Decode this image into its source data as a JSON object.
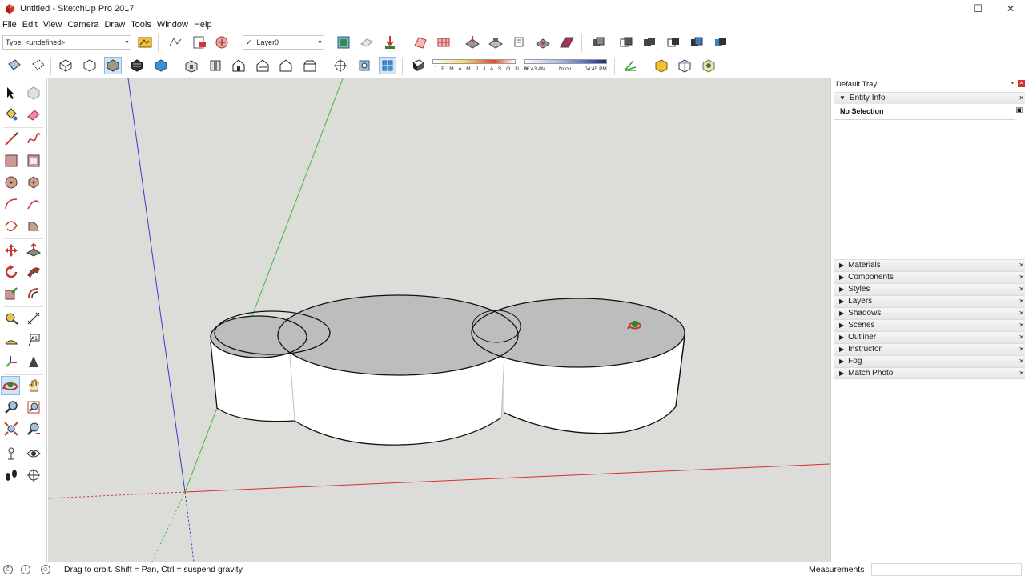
{
  "window": {
    "title": "Untitled - SketchUp Pro 2017",
    "minimize_glyph": "—",
    "maximize_glyph": "☐",
    "close_glyph": "✕"
  },
  "menu": [
    "File",
    "Edit",
    "View",
    "Camera",
    "Draw",
    "Tools",
    "Window",
    "Help"
  ],
  "toolbar": {
    "type_selector": {
      "value": "Type: <undefined>"
    },
    "layer_selector": {
      "check": "✓",
      "value": "Layer0"
    },
    "shadow_months": "J F M A M J J A S O N D",
    "shadow_time_start": "06:43 AM",
    "shadow_time_noon": "Noon",
    "shadow_time_end": "04:45 PM"
  },
  "tray": {
    "title": "Default Tray",
    "entity_info": {
      "label": "Entity Info",
      "content": "No Selection"
    },
    "panels": [
      "Materials",
      "Components",
      "Styles",
      "Layers",
      "Shadows",
      "Scenes",
      "Outliner",
      "Instructor",
      "Fog",
      "Match Photo"
    ]
  },
  "statusbar": {
    "message": "Drag to orbit. Shift = Pan, Ctrl = suspend gravity.",
    "measurements_label": "Measurements",
    "measurements_value": ""
  },
  "colors": {
    "viewport_bg": "#dcdcd9",
    "axis_red": "#d63030",
    "axis_green": "#3fb83f",
    "axis_blue": "#3a3ad0",
    "face_top": "#bdbdbd",
    "face_side": "#ffffff",
    "active_tool": "#cfe4f7"
  },
  "icons": {
    "app": "sketchup-logo-icon",
    "orbit_cursor": "orbit-cursor-icon"
  }
}
